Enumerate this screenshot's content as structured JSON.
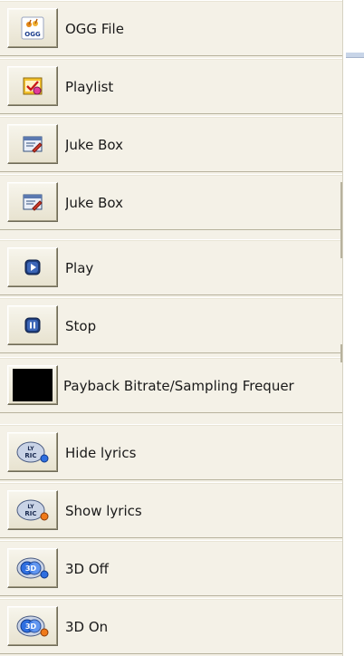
{
  "menu": {
    "items": [
      {
        "label": "OGG File",
        "icon": "ogg-file-icon"
      },
      {
        "label": "Playlist",
        "icon": "playlist-icon"
      },
      {
        "label": "Juke Box",
        "icon": "jukebox-icon"
      },
      {
        "label": "Juke Box",
        "icon": "jukebox-icon"
      },
      {
        "label": "Play",
        "icon": "play-icon"
      },
      {
        "label": "Stop",
        "icon": "stop-icon"
      },
      {
        "label": "Payback Bitrate/Sampling Frequer",
        "icon": "black-swatch-icon"
      },
      {
        "label": "Hide lyrics",
        "icon": "lyrics-hide-icon"
      },
      {
        "label": "Show lyrics",
        "icon": "lyrics-show-icon"
      },
      {
        "label": "3D Off",
        "icon": "3d-off-icon"
      },
      {
        "label": "3D On",
        "icon": "3d-on-icon"
      }
    ]
  },
  "colors": {
    "panel_bg": "#f4f1e7",
    "row_border": "#b7b29d",
    "text": "#1a1a1a"
  }
}
